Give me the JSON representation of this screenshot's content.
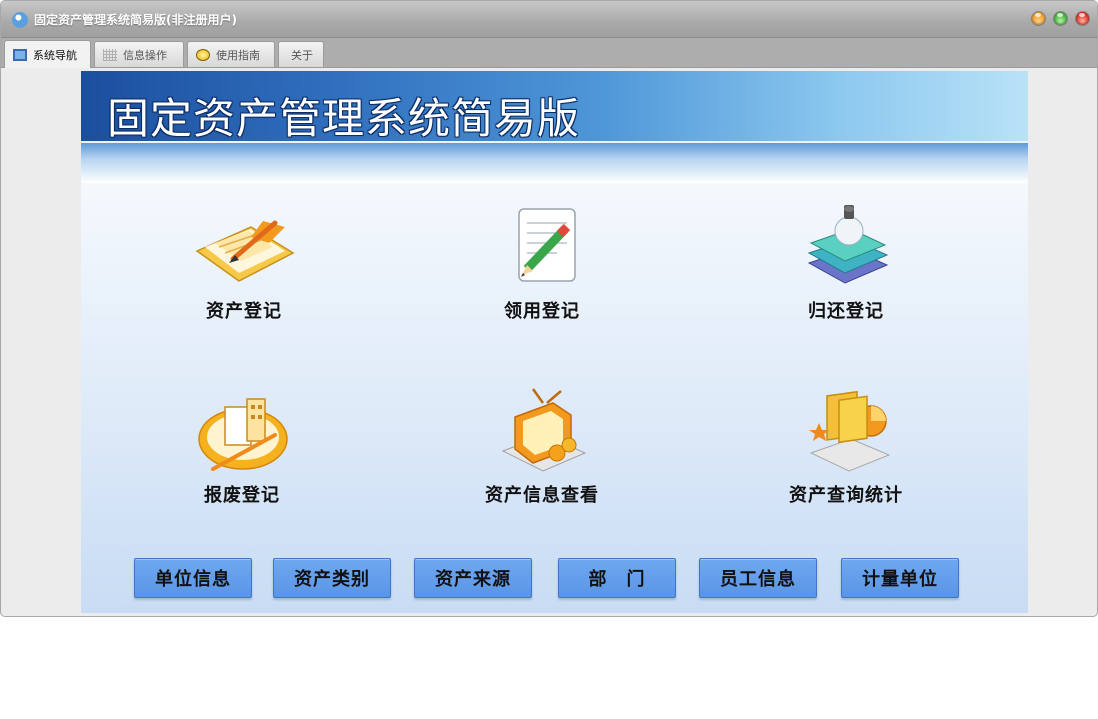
{
  "window": {
    "title": "固定资产管理系统简易版(非注册用户)",
    "controls": [
      "minimize-button",
      "maximize-button",
      "close-button"
    ],
    "control_colors": {
      "minimize": "#f2a12e",
      "maximize": "#48b544",
      "close": "#e0362a"
    }
  },
  "tabs": [
    {
      "label": "系统导航",
      "icon": "monitor-icon",
      "active": true
    },
    {
      "label": "信息操作",
      "icon": "grid-icon",
      "active": false
    },
    {
      "label": "使用指南",
      "icon": "lightbulb-icon",
      "active": false
    },
    {
      "label": "关于",
      "icon": "",
      "active": false
    }
  ],
  "banner": {
    "title": "固定资产管理系统简易版"
  },
  "features": [
    {
      "label": "资产登记",
      "icon": "register-folder-icon"
    },
    {
      "label": "领用登记",
      "icon": "notepad-pencil-icon"
    },
    {
      "label": "归还登记",
      "icon": "books-lamp-icon"
    },
    {
      "label": "报废登记",
      "icon": "scrap-building-icon"
    },
    {
      "label": "资产信息查看",
      "icon": "tv-fruit-icon"
    },
    {
      "label": "资产查询统计",
      "icon": "stats-folder-icon"
    }
  ],
  "bottom_buttons": [
    {
      "label": "单位信息"
    },
    {
      "label": "资产类别"
    },
    {
      "label": "资产来源"
    },
    {
      "label": "部　门"
    },
    {
      "label": "员工信息"
    },
    {
      "label": "计量单位"
    }
  ],
  "colors": {
    "accent": "#5a95e6",
    "banner_dark": "#1b4f9e",
    "banner_light": "#b9e2f7"
  }
}
